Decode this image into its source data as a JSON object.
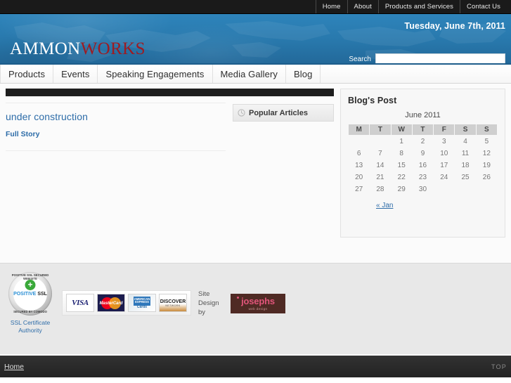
{
  "topbar": {
    "links": [
      {
        "label": "Home"
      },
      {
        "label": "About"
      },
      {
        "label": "Products and Services"
      },
      {
        "label": "Contact Us"
      }
    ]
  },
  "header": {
    "logo_first": "AMMON",
    "logo_second": "WORKS",
    "date": "Tuesday, June 7th, 2011",
    "search_label": "Search",
    "search_value": "",
    "search_placeholder": "",
    "brand_blue": "#2878ac",
    "brand_red": "#9e1b22"
  },
  "mainnav": {
    "items": [
      {
        "label": "Products"
      },
      {
        "label": "Events"
      },
      {
        "label": "Speaking Engagements"
      },
      {
        "label": "Media Gallery"
      },
      {
        "label": "Blog"
      }
    ]
  },
  "main": {
    "article": {
      "title": "under construction",
      "link_label": "Full Story"
    },
    "popular": {
      "icon": "clock-icon",
      "title": "Popular Articles"
    }
  },
  "sidebar": {
    "title": "Blog's Post",
    "calendar": {
      "caption": "June 2011",
      "weekdays": [
        "M",
        "T",
        "W",
        "T",
        "F",
        "S",
        "S"
      ],
      "weeks": [
        [
          "",
          "",
          "1",
          "2",
          "3",
          "4",
          "5"
        ],
        [
          "6",
          "7",
          "8",
          "9",
          "10",
          "11",
          "12"
        ],
        [
          "13",
          "14",
          "15",
          "16",
          "17",
          "18",
          "19"
        ],
        [
          "20",
          "21",
          "22",
          "23",
          "24",
          "25",
          "26"
        ],
        [
          "27",
          "28",
          "29",
          "30",
          "",
          "",
          ""
        ]
      ],
      "prev_label": "« Jan"
    }
  },
  "badges": {
    "ssl": {
      "arc_top": "POSITIVE SSL SECURED WEBSITE",
      "arc_bottom": "SECURED BY COMODO",
      "mid_first": "POSITIVE",
      "mid_second": "SSL",
      "caption": "SSL Certificate Authority"
    },
    "cards": [
      {
        "name": "visa",
        "label": "VISA"
      },
      {
        "name": "mastercard",
        "label": "MasterCard"
      },
      {
        "name": "american-express",
        "label": "AMERICAN EXPRESS",
        "sub": "Cards"
      },
      {
        "name": "discover",
        "label": "DISCOVER",
        "sub": "NETWORK"
      }
    ],
    "design": {
      "text": "Site Design by",
      "logo_name": "josephs",
      "logo_sub": "web design"
    }
  },
  "footer": {
    "home_label": "Home",
    "top_label": "TOP"
  }
}
